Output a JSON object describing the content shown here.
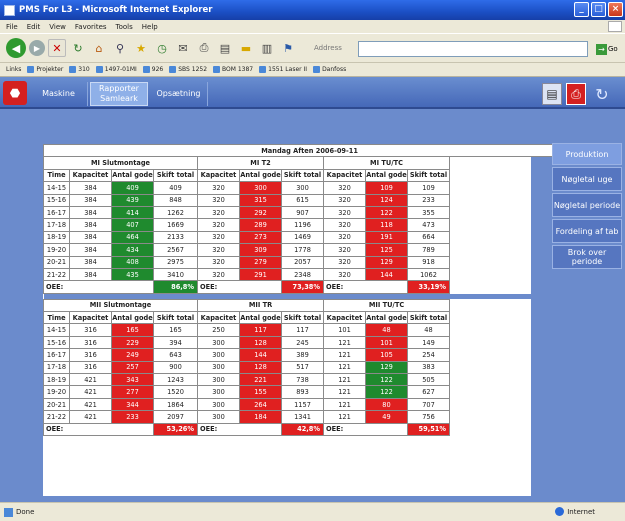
{
  "window": {
    "title": "PMS For L3 - Microsoft Internet Explorer"
  },
  "menu": [
    "File",
    "Edit",
    "View",
    "Favorites",
    "Tools",
    "Help"
  ],
  "toolbar": {
    "address_label": "Address",
    "go_label": "Go"
  },
  "links": [
    "Links",
    "Projekter",
    "310",
    "1497-01MI",
    "926",
    "SBS 1252",
    "BOM 1387",
    "1551 Laser II",
    "Danfoss"
  ],
  "app": {
    "tabs": [
      {
        "label": "Maskine"
      },
      {
        "label": "Rapporter Samleark",
        "active": true
      },
      {
        "label": "Opsætning"
      }
    ],
    "sidebar": [
      {
        "label": "Produktion",
        "active": true
      },
      {
        "label": "Nøgletal uge"
      },
      {
        "label": "Nøgletal periode"
      },
      {
        "label": "Fordeling af tab"
      },
      {
        "label": "Brok over periode"
      }
    ]
  },
  "report": {
    "title": "Mandag Aften 2006-09-11",
    "columns": [
      "Time",
      "Kapacitet",
      "Antal gode",
      "Skift total"
    ],
    "oee_label": "OEE:",
    "sections": [
      {
        "lines": [
          {
            "name": "MI Slutmontage",
            "oee": "86,8%",
            "oee_color": "#1f8a2e",
            "rows": [
              [
                [
                  "14-15"
                ],
                [
                  "384"
                ],
                [
                  "409",
                  "g"
                ],
                [
                  "409"
                ]
              ],
              [
                [
                  "15-16"
                ],
                [
                  "384"
                ],
                [
                  "439",
                  "g"
                ],
                [
                  "848"
                ]
              ],
              [
                [
                  "16-17"
                ],
                [
                  "384"
                ],
                [
                  "414",
                  "g"
                ],
                [
                  "1262"
                ]
              ],
              [
                [
                  "17-18"
                ],
                [
                  "384"
                ],
                [
                  "407",
                  "g"
                ],
                [
                  "1669"
                ]
              ],
              [
                [
                  "18-19"
                ],
                [
                  "384"
                ],
                [
                  "464",
                  "g"
                ],
                [
                  "2133"
                ]
              ],
              [
                [
                  "19-20"
                ],
                [
                  "384"
                ],
                [
                  "434",
                  "g"
                ],
                [
                  "2567"
                ]
              ],
              [
                [
                  "20-21"
                ],
                [
                  "384"
                ],
                [
                  "408",
                  "g"
                ],
                [
                  "2975"
                ]
              ],
              [
                [
                  "21-22"
                ],
                [
                  "384"
                ],
                [
                  "435",
                  "g"
                ],
                [
                  "3410"
                ]
              ]
            ]
          },
          {
            "name": "MI T2",
            "oee": "73,38%",
            "oee_color": "#e02020",
            "rows": [
              [
                [
                  "320"
                ],
                [
                  "300",
                  "r"
                ],
                [
                  "300"
                ]
              ],
              [
                [
                  "320"
                ],
                [
                  "315",
                  "r"
                ],
                [
                  "615"
                ]
              ],
              [
                [
                  "320"
                ],
                [
                  "292",
                  "r"
                ],
                [
                  "907"
                ]
              ],
              [
                [
                  "320"
                ],
                [
                  "289",
                  "r"
                ],
                [
                  "1196"
                ]
              ],
              [
                [
                  "320"
                ],
                [
                  "273",
                  "r"
                ],
                [
                  "1469"
                ]
              ],
              [
                [
                  "320"
                ],
                [
                  "309",
                  "r"
                ],
                [
                  "1778"
                ]
              ],
              [
                [
                  "320"
                ],
                [
                  "279",
                  "r"
                ],
                [
                  "2057"
                ]
              ],
              [
                [
                  "320"
                ],
                [
                  "291",
                  "r"
                ],
                [
                  "2348"
                ]
              ]
            ]
          },
          {
            "name": "MI TU/TC",
            "oee": "33,19%",
            "oee_color": "#e02020",
            "rows": [
              [
                [
                  "320"
                ],
                [
                  "109",
                  "r"
                ],
                [
                  "109"
                ]
              ],
              [
                [
                  "320"
                ],
                [
                  "124",
                  "r"
                ],
                [
                  "233"
                ]
              ],
              [
                [
                  "320"
                ],
                [
                  "122",
                  "r"
                ],
                [
                  "355"
                ]
              ],
              [
                [
                  "320"
                ],
                [
                  "118",
                  "r"
                ],
                [
                  "473"
                ]
              ],
              [
                [
                  "320"
                ],
                [
                  "191",
                  "r"
                ],
                [
                  "664"
                ]
              ],
              [
                [
                  "320"
                ],
                [
                  "125",
                  "r"
                ],
                [
                  "789"
                ]
              ],
              [
                [
                  "320"
                ],
                [
                  "129",
                  "r"
                ],
                [
                  "918"
                ]
              ],
              [
                [
                  "320"
                ],
                [
                  "144",
                  "r"
                ],
                [
                  "1062"
                ]
              ]
            ]
          }
        ]
      },
      {
        "lines": [
          {
            "name": "MII Slutmontage",
            "oee": "53,26%",
            "oee_color": "#e02020",
            "rows": [
              [
                [
                  "14-15"
                ],
                [
                  "316"
                ],
                [
                  "165",
                  "r"
                ],
                [
                  "165"
                ]
              ],
              [
                [
                  "15-16"
                ],
                [
                  "316"
                ],
                [
                  "229",
                  "r"
                ],
                [
                  "394"
                ]
              ],
              [
                [
                  "16-17"
                ],
                [
                  "316"
                ],
                [
                  "249",
                  "r"
                ],
                [
                  "643"
                ]
              ],
              [
                [
                  "17-18"
                ],
                [
                  "316"
                ],
                [
                  "257",
                  "r"
                ],
                [
                  "900"
                ]
              ],
              [
                [
                  "18-19"
                ],
                [
                  "421"
                ],
                [
                  "343",
                  "r"
                ],
                [
                  "1243"
                ]
              ],
              [
                [
                  "19-20"
                ],
                [
                  "421"
                ],
                [
                  "277",
                  "r"
                ],
                [
                  "1520"
                ]
              ],
              [
                [
                  "20-21"
                ],
                [
                  "421"
                ],
                [
                  "344",
                  "r"
                ],
                [
                  "1864"
                ]
              ],
              [
                [
                  "21-22"
                ],
                [
                  "421"
                ],
                [
                  "233",
                  "r"
                ],
                [
                  "2097"
                ]
              ]
            ]
          },
          {
            "name": "MII TR",
            "oee": "42,8%",
            "oee_color": "#e02020",
            "rows": [
              [
                [
                  "250"
                ],
                [
                  "117",
                  "r"
                ],
                [
                  "117"
                ]
              ],
              [
                [
                  "300"
                ],
                [
                  "128",
                  "r"
                ],
                [
                  "245"
                ]
              ],
              [
                [
                  "300"
                ],
                [
                  "144",
                  "r"
                ],
                [
                  "389"
                ]
              ],
              [
                [
                  "300"
                ],
                [
                  "128",
                  "r"
                ],
                [
                  "517"
                ]
              ],
              [
                [
                  "300"
                ],
                [
                  "221",
                  "r"
                ],
                [
                  "738"
                ]
              ],
              [
                [
                  "300"
                ],
                [
                  "155",
                  "r"
                ],
                [
                  "893"
                ]
              ],
              [
                [
                  "300"
                ],
                [
                  "264",
                  "r"
                ],
                [
                  "1157"
                ]
              ],
              [
                [
                  "300"
                ],
                [
                  "184",
                  "r"
                ],
                [
                  "1341"
                ]
              ]
            ]
          },
          {
            "name": "MII TU/TC",
            "oee": "59,51%",
            "oee_color": "#e02020",
            "rows": [
              [
                [
                  "101"
                ],
                [
                  "48",
                  "r"
                ],
                [
                  "48"
                ]
              ],
              [
                [
                  "121"
                ],
                [
                  "101",
                  "r"
                ],
                [
                  "149"
                ]
              ],
              [
                [
                  "121"
                ],
                [
                  "105",
                  "r"
                ],
                [
                  "254"
                ]
              ],
              [
                [
                  "121"
                ],
                [
                  "129",
                  "g"
                ],
                [
                  "383"
                ]
              ],
              [
                [
                  "121"
                ],
                [
                  "122",
                  "g"
                ],
                [
                  "505"
                ]
              ],
              [
                [
                  "121"
                ],
                [
                  "122",
                  "g"
                ],
                [
                  "627"
                ]
              ],
              [
                [
                  "121"
                ],
                [
                  "80",
                  "r"
                ],
                [
                  "707"
                ]
              ],
              [
                [
                  "121"
                ],
                [
                  "49",
                  "r"
                ],
                [
                  "756"
                ]
              ]
            ]
          }
        ]
      }
    ]
  },
  "status": {
    "left": "Done",
    "zone": "Internet"
  }
}
